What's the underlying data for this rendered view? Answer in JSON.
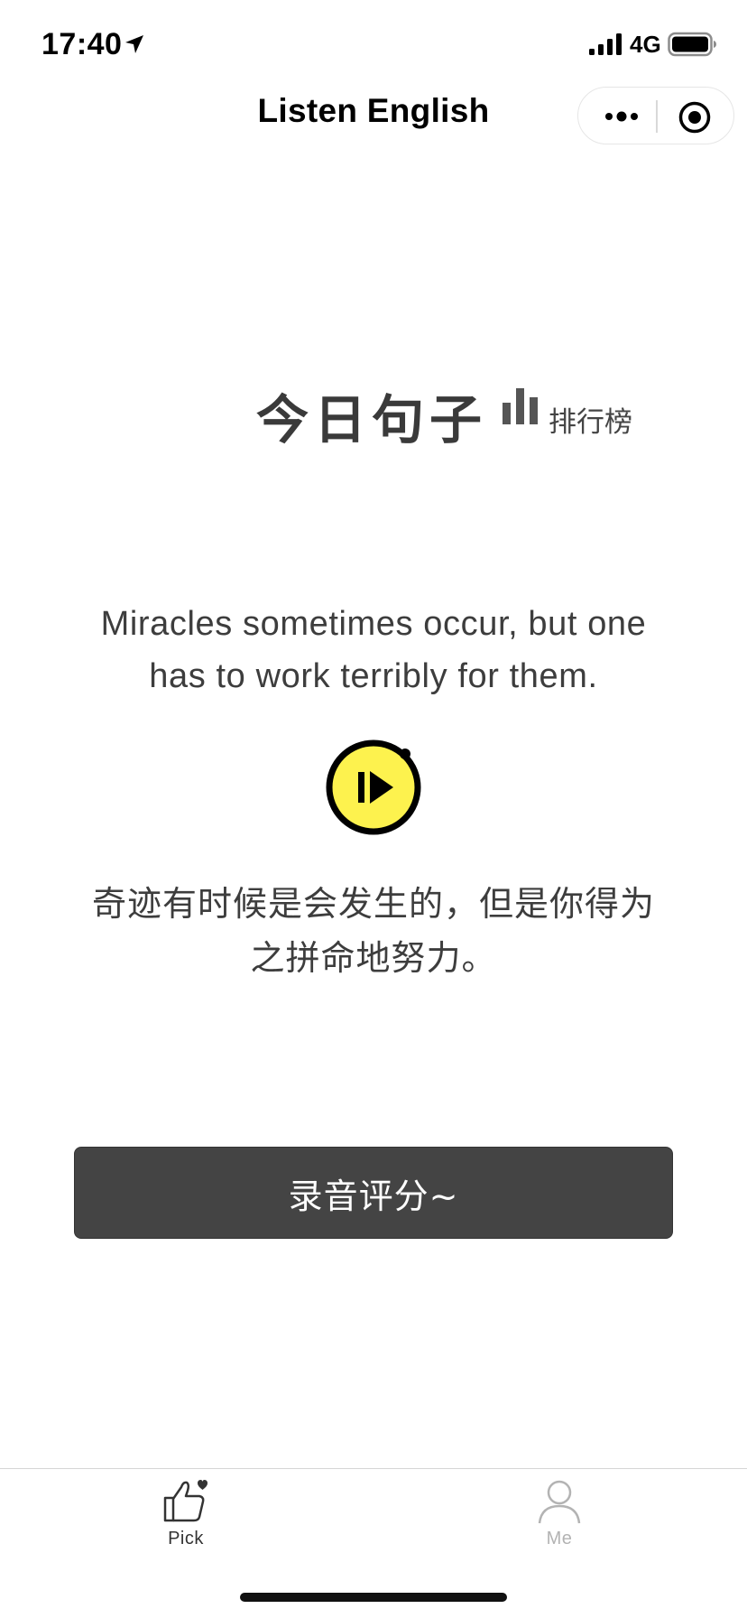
{
  "status_bar": {
    "time": "17:40",
    "network": "4G",
    "icons": [
      "location-arrow-icon",
      "signal-icon",
      "battery-icon"
    ]
  },
  "nav": {
    "title": "Listen English",
    "capsule_icons": [
      "more-icon",
      "close-icon"
    ]
  },
  "header": {
    "title": "今日句子",
    "ranking_label": "排行榜",
    "ranking_icon": "bar-chart-icon"
  },
  "sentence": {
    "english": "Miracles sometimes occur, but one has to work terribly for them.",
    "chinese": "奇迹有时候是会发生的，但是你得为之拼命地努力。",
    "play_icon": "play-audio-icon"
  },
  "actions": {
    "record_label": "录音评分~"
  },
  "tabs": [
    {
      "label": "Pick",
      "icon": "thumbs-up-icon",
      "active": true
    },
    {
      "label": "Me",
      "icon": "person-icon",
      "active": false
    }
  ],
  "colors": {
    "accent_yellow": "#fdf24e",
    "button_dark": "#444444",
    "text_gray": "#3d3d3d",
    "inactive_tab": "#b3b3b3"
  }
}
